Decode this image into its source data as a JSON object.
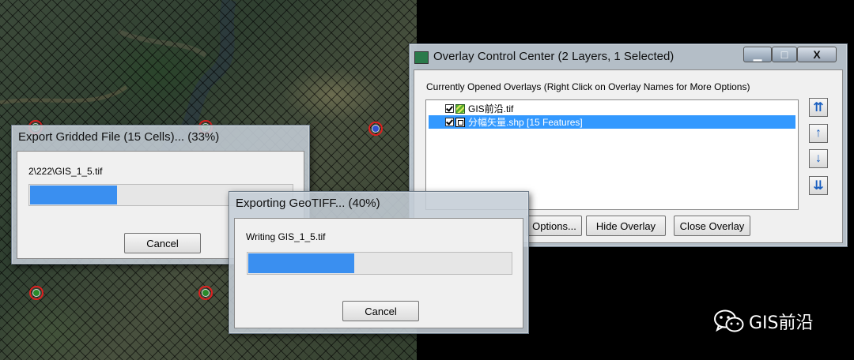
{
  "map": {
    "markers": [
      {
        "name": "map-marker-1",
        "kind": "green"
      },
      {
        "name": "map-marker-2",
        "kind": "green"
      },
      {
        "name": "map-marker-3",
        "kind": "blue"
      },
      {
        "name": "map-marker-4",
        "kind": "green"
      },
      {
        "name": "map-marker-5",
        "kind": "green"
      }
    ]
  },
  "export_dialog": {
    "title": "Export Gridded File (15 Cells)... (33%)",
    "file_path": "2\\222\\GIS_1_5.tif",
    "progress": 0.33,
    "cancel_label": "Cancel"
  },
  "geotiff_dialog": {
    "title": "Exporting GeoTIFF... (40%)",
    "status": "Writing GIS_1_5.tif",
    "progress": 0.4,
    "cancel_label": "Cancel"
  },
  "overlay_control": {
    "title": "Overlay Control Center (2 Layers, 1 Selected)",
    "window_buttons": {
      "minimize": "▁",
      "maximize": "□",
      "close": "X"
    },
    "heading": "Currently Opened Overlays (Right Click on Overlay Names for More Options)",
    "layers": [
      {
        "name": "GIS前沿.tif",
        "checked": true,
        "type": "raster",
        "selected": false
      },
      {
        "name": "分幅矢量.shp [15 Features]",
        "checked": true,
        "type": "vector",
        "selected": true
      }
    ],
    "buttons": {
      "options": "Options...",
      "hide": "Hide Overlay",
      "close": "Close Overlay"
    },
    "arrow_buttons": [
      "move-to-top",
      "move-up",
      "move-down",
      "move-to-bottom"
    ]
  },
  "watermark": {
    "text": "GIS前沿",
    "icon": "wechat-icon"
  },
  "colors": {
    "progress_fill": "#3a8ff0",
    "selection": "#3399ff",
    "marker_ring": "#e02020"
  }
}
